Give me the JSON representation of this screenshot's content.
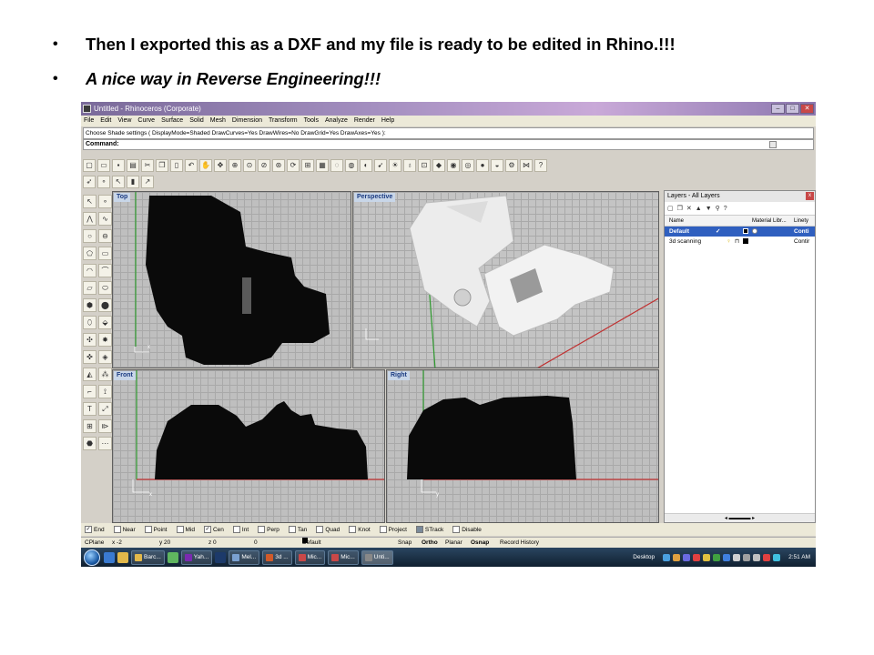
{
  "slide": {
    "bullets": [
      "Then I exported this as a DXF and my file is ready to be edited in Rhino.!!!",
      "A nice way in Reverse Engineering!!!"
    ]
  },
  "window": {
    "title": "Untitled - Rhinoceros (Corporate)"
  },
  "menu": [
    "File",
    "Edit",
    "View",
    "Curve",
    "Surface",
    "Solid",
    "Mesh",
    "Dimension",
    "Transform",
    "Tools",
    "Analyze",
    "Render",
    "Help"
  ],
  "command": {
    "history": "Choose Shade settings ( DisplayMode=Shaded  DrawCurves=Yes  DrawWires=No  DrawGrid=Yes  DrawAxes=Yes ):",
    "prompt": "Command:"
  },
  "viewports": {
    "top": "Top",
    "perspective": "Perspective",
    "front": "Front",
    "right": "Right"
  },
  "layers_panel": {
    "title": "Layers - All Layers",
    "close": "x",
    "col_name": "Name",
    "col_material": "Material Libr...",
    "col_linetype": "Linety",
    "rows": [
      {
        "name": "Default",
        "current": "✓",
        "linetype": "Conti",
        "selected": true
      },
      {
        "name": "3d scanning",
        "current": "",
        "linetype": "Contir",
        "selected": false
      }
    ]
  },
  "osnap": [
    "End",
    "Near",
    "Point",
    "Mid",
    "Cen",
    "Int",
    "Perp",
    "Tan",
    "Quad",
    "Knot",
    "Project",
    "STrack",
    "Disable"
  ],
  "status": {
    "cplane": "CPlane",
    "x": "x -2",
    "y": "y 20",
    "z": "z 0",
    "dist": "0",
    "layer": "Default",
    "snap": "Snap",
    "ortho": "Ortho",
    "planar": "Planar",
    "osnap": "Osnap",
    "record": "Record History"
  },
  "taskbar": {
    "tasks": [
      "Barc...",
      "Yah...",
      "Mel...",
      "3d ...",
      "Mic...",
      "Mic...",
      "Unti..."
    ],
    "desktop": "Desktop",
    "clock": "2:51 AM"
  },
  "colors": {
    "selected_layer": "#2f5fbf",
    "viewport_grid": "#bfbfbf",
    "axis_red": "#c03030",
    "axis_green": "#2e9a2e"
  }
}
